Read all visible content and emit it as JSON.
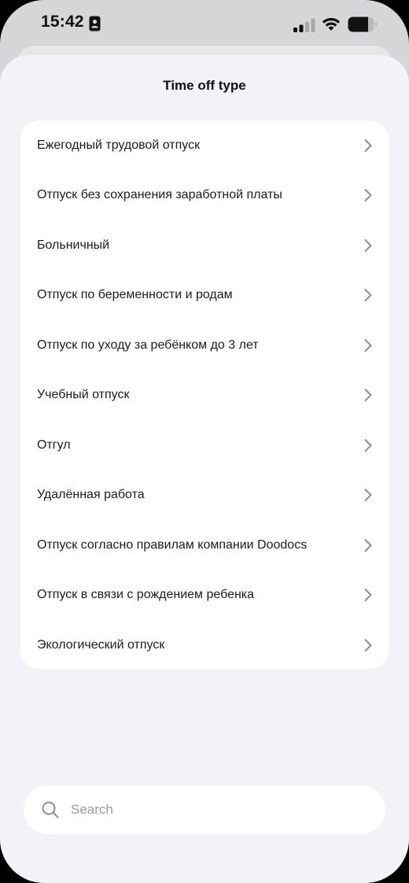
{
  "status_bar": {
    "time": "15:42",
    "icons": [
      "focus-icon",
      "signal-icon",
      "wifi-icon",
      "battery-icon"
    ]
  },
  "sheet": {
    "title": "Time off type"
  },
  "items": [
    {
      "label": "Ежегодный трудовой отпуск"
    },
    {
      "label": "Отпуск без сохранения заработной платы"
    },
    {
      "label": "Больничный"
    },
    {
      "label": "Отпуск по беременности и родам"
    },
    {
      "label": "Отпуск по уходу за ребёнком до 3 лет"
    },
    {
      "label": "Учебный отпуск"
    },
    {
      "label": "Отгул"
    },
    {
      "label": "Удалённая работа"
    },
    {
      "label": "Отпуск согласно правилам компании Doodocs"
    },
    {
      "label": "Отпуск в связи с рождением ребенка"
    },
    {
      "label": "Экологический отпуск"
    }
  ],
  "search": {
    "placeholder": "Search",
    "value": ""
  },
  "colors": {
    "sheet_background": "#f2f2f7",
    "card_background": "#ffffff",
    "text": "#1c1c1e",
    "chevron": "#8e8e93",
    "placeholder": "#9b9ba1"
  }
}
